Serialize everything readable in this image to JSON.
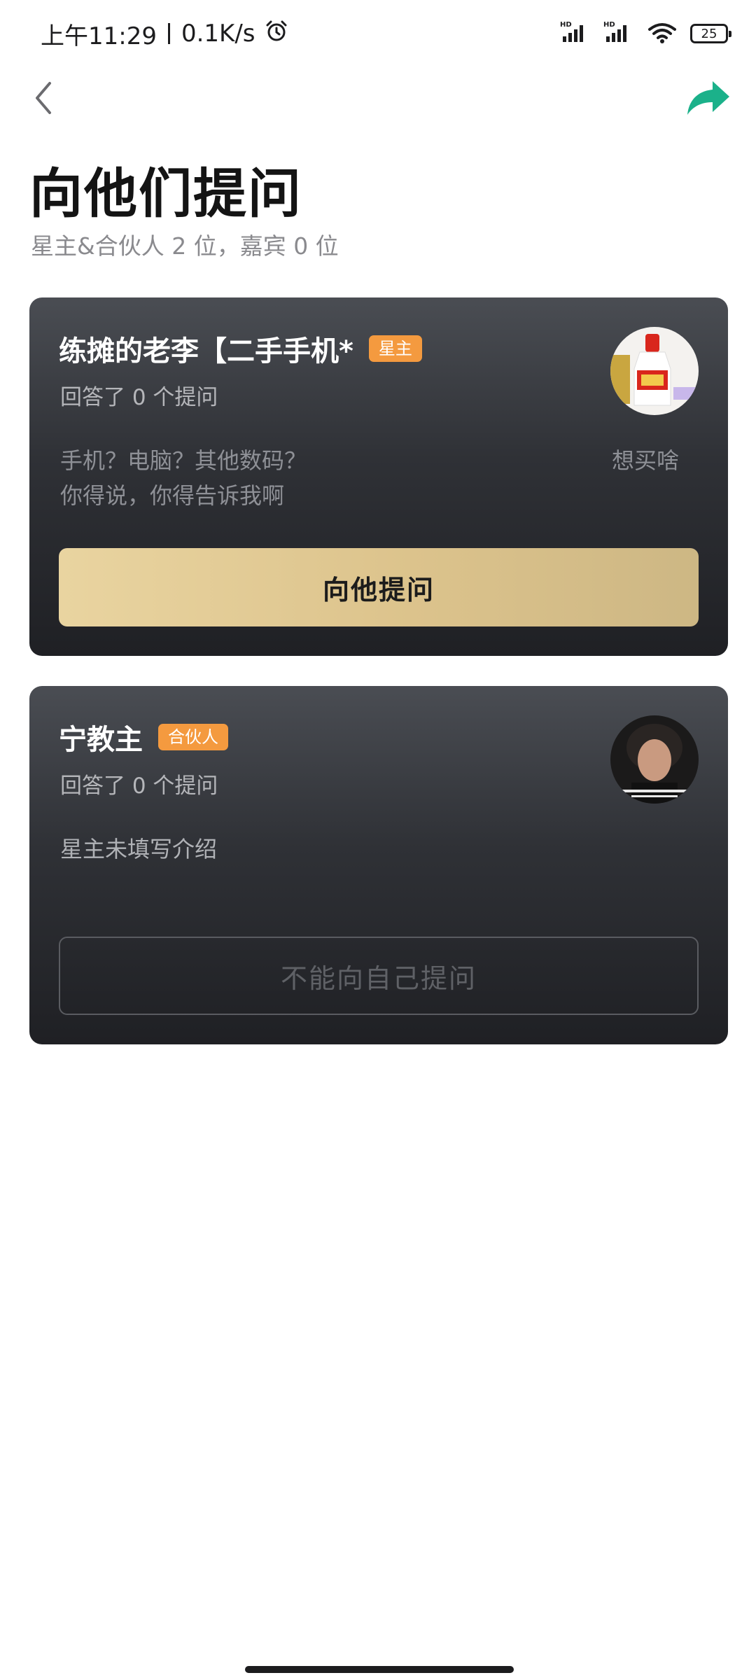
{
  "status_bar": {
    "time": "上午11:29",
    "speed": "0.1K/s",
    "battery": "25"
  },
  "colors": {
    "accent": "#1bb18a",
    "badge": "#f49a3f",
    "gold_button": "#e3cc95",
    "card_bg": "#35373c"
  },
  "header": {
    "title": "向他们提问",
    "subtitle": "星主&合伙人 2 位，嘉宾 0 位"
  },
  "cards": [
    {
      "name": "练摊的老李【二手手机*",
      "badge": "星主",
      "answers": "回答了 0 个提问",
      "intro_line1": "手机？电脑？其他数码？",
      "intro_line2": "你得说，你得告诉我啊",
      "want": "想买啥",
      "button": "向他提问"
    },
    {
      "name": "宁教主",
      "badge": "合伙人",
      "answers": "回答了 0 个提问",
      "intro_line1": "星主未填写介绍",
      "button": "不能向自己提问"
    }
  ]
}
